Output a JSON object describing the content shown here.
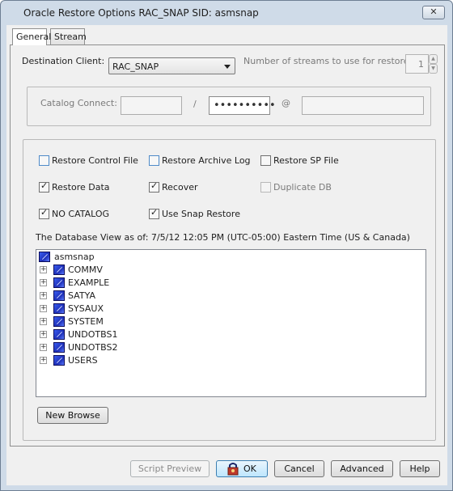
{
  "window": {
    "title": "Oracle Restore Options RAC_SNAP   SID: asmsnap",
    "close_glyph": "✕"
  },
  "tabs": [
    {
      "label": "General",
      "active": true
    },
    {
      "label": "Stream",
      "active": false
    }
  ],
  "destination": {
    "label": "Destination Client:",
    "value": "RAC_SNAP"
  },
  "streams": {
    "label": "Number of streams to use for restore:",
    "value": "1"
  },
  "catalog": {
    "label": "Catalog Connect:",
    "separator_slash": "/",
    "separator_at": "@",
    "user": "",
    "password_mask": "••••••••••",
    "service": ""
  },
  "options": {
    "restore_control_file": {
      "label": "Restore Control File",
      "checked": false
    },
    "restore_archive_log": {
      "label": "Restore Archive Log",
      "checked": false
    },
    "restore_sp_file": {
      "label": "Restore SP File",
      "checked": false
    },
    "restore_data": {
      "label": "Restore Data",
      "checked": true
    },
    "recover": {
      "label": "Recover",
      "checked": true
    },
    "duplicate_db": {
      "label": "Duplicate DB",
      "checked": false,
      "enabled": false
    },
    "no_catalog": {
      "label": "NO CATALOG",
      "checked": true
    },
    "use_snap_restore": {
      "label": "Use Snap Restore",
      "checked": true
    }
  },
  "database_view": "The Database View as of: 7/5/12 12:05 PM (UTC-05:00) Eastern Time (US & Canada)",
  "tree": {
    "root": "asmsnap",
    "items": [
      "COMMV",
      "EXAMPLE",
      "SATYA",
      "SYSAUX",
      "SYSTEM",
      "UNDOTBS1",
      "UNDOTBS2",
      "USERS"
    ],
    "expander_glyph": "+"
  },
  "buttons": {
    "new_browse": "New Browse",
    "script_preview": "Script Preview",
    "ok": "OK",
    "cancel": "Cancel",
    "advanced": "Advanced",
    "help": "Help"
  },
  "colors": {
    "title_bar": "#cfdbe8",
    "db_icon": "#1e2fb8"
  }
}
